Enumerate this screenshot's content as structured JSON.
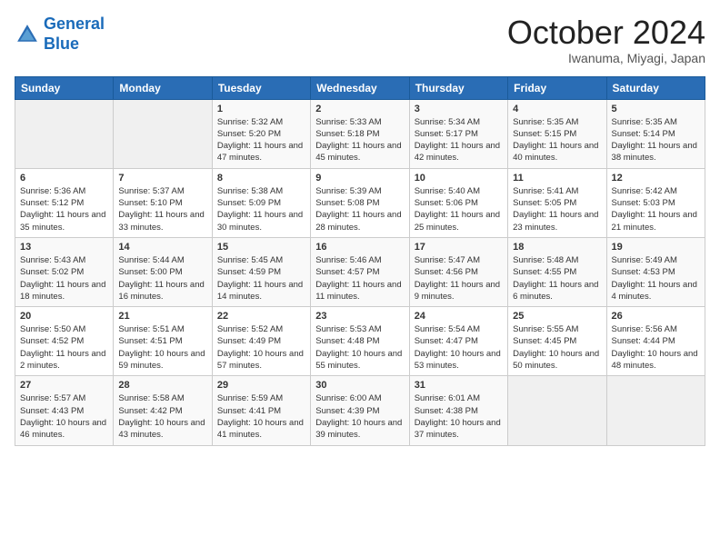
{
  "logo": {
    "line1": "General",
    "line2": "Blue"
  },
  "title": "October 2024",
  "location": "Iwanuma, Miyagi, Japan",
  "weekdays": [
    "Sunday",
    "Monday",
    "Tuesday",
    "Wednesday",
    "Thursday",
    "Friday",
    "Saturday"
  ],
  "weeks": [
    [
      {
        "day": "",
        "info": ""
      },
      {
        "day": "",
        "info": ""
      },
      {
        "day": "1",
        "info": "Sunrise: 5:32 AM\nSunset: 5:20 PM\nDaylight: 11 hours and 47 minutes."
      },
      {
        "day": "2",
        "info": "Sunrise: 5:33 AM\nSunset: 5:18 PM\nDaylight: 11 hours and 45 minutes."
      },
      {
        "day": "3",
        "info": "Sunrise: 5:34 AM\nSunset: 5:17 PM\nDaylight: 11 hours and 42 minutes."
      },
      {
        "day": "4",
        "info": "Sunrise: 5:35 AM\nSunset: 5:15 PM\nDaylight: 11 hours and 40 minutes."
      },
      {
        "day": "5",
        "info": "Sunrise: 5:35 AM\nSunset: 5:14 PM\nDaylight: 11 hours and 38 minutes."
      }
    ],
    [
      {
        "day": "6",
        "info": "Sunrise: 5:36 AM\nSunset: 5:12 PM\nDaylight: 11 hours and 35 minutes."
      },
      {
        "day": "7",
        "info": "Sunrise: 5:37 AM\nSunset: 5:10 PM\nDaylight: 11 hours and 33 minutes."
      },
      {
        "day": "8",
        "info": "Sunrise: 5:38 AM\nSunset: 5:09 PM\nDaylight: 11 hours and 30 minutes."
      },
      {
        "day": "9",
        "info": "Sunrise: 5:39 AM\nSunset: 5:08 PM\nDaylight: 11 hours and 28 minutes."
      },
      {
        "day": "10",
        "info": "Sunrise: 5:40 AM\nSunset: 5:06 PM\nDaylight: 11 hours and 25 minutes."
      },
      {
        "day": "11",
        "info": "Sunrise: 5:41 AM\nSunset: 5:05 PM\nDaylight: 11 hours and 23 minutes."
      },
      {
        "day": "12",
        "info": "Sunrise: 5:42 AM\nSunset: 5:03 PM\nDaylight: 11 hours and 21 minutes."
      }
    ],
    [
      {
        "day": "13",
        "info": "Sunrise: 5:43 AM\nSunset: 5:02 PM\nDaylight: 11 hours and 18 minutes."
      },
      {
        "day": "14",
        "info": "Sunrise: 5:44 AM\nSunset: 5:00 PM\nDaylight: 11 hours and 16 minutes."
      },
      {
        "day": "15",
        "info": "Sunrise: 5:45 AM\nSunset: 4:59 PM\nDaylight: 11 hours and 14 minutes."
      },
      {
        "day": "16",
        "info": "Sunrise: 5:46 AM\nSunset: 4:57 PM\nDaylight: 11 hours and 11 minutes."
      },
      {
        "day": "17",
        "info": "Sunrise: 5:47 AM\nSunset: 4:56 PM\nDaylight: 11 hours and 9 minutes."
      },
      {
        "day": "18",
        "info": "Sunrise: 5:48 AM\nSunset: 4:55 PM\nDaylight: 11 hours and 6 minutes."
      },
      {
        "day": "19",
        "info": "Sunrise: 5:49 AM\nSunset: 4:53 PM\nDaylight: 11 hours and 4 minutes."
      }
    ],
    [
      {
        "day": "20",
        "info": "Sunrise: 5:50 AM\nSunset: 4:52 PM\nDaylight: 11 hours and 2 minutes."
      },
      {
        "day": "21",
        "info": "Sunrise: 5:51 AM\nSunset: 4:51 PM\nDaylight: 10 hours and 59 minutes."
      },
      {
        "day": "22",
        "info": "Sunrise: 5:52 AM\nSunset: 4:49 PM\nDaylight: 10 hours and 57 minutes."
      },
      {
        "day": "23",
        "info": "Sunrise: 5:53 AM\nSunset: 4:48 PM\nDaylight: 10 hours and 55 minutes."
      },
      {
        "day": "24",
        "info": "Sunrise: 5:54 AM\nSunset: 4:47 PM\nDaylight: 10 hours and 53 minutes."
      },
      {
        "day": "25",
        "info": "Sunrise: 5:55 AM\nSunset: 4:45 PM\nDaylight: 10 hours and 50 minutes."
      },
      {
        "day": "26",
        "info": "Sunrise: 5:56 AM\nSunset: 4:44 PM\nDaylight: 10 hours and 48 minutes."
      }
    ],
    [
      {
        "day": "27",
        "info": "Sunrise: 5:57 AM\nSunset: 4:43 PM\nDaylight: 10 hours and 46 minutes."
      },
      {
        "day": "28",
        "info": "Sunrise: 5:58 AM\nSunset: 4:42 PM\nDaylight: 10 hours and 43 minutes."
      },
      {
        "day": "29",
        "info": "Sunrise: 5:59 AM\nSunset: 4:41 PM\nDaylight: 10 hours and 41 minutes."
      },
      {
        "day": "30",
        "info": "Sunrise: 6:00 AM\nSunset: 4:39 PM\nDaylight: 10 hours and 39 minutes."
      },
      {
        "day": "31",
        "info": "Sunrise: 6:01 AM\nSunset: 4:38 PM\nDaylight: 10 hours and 37 minutes."
      },
      {
        "day": "",
        "info": ""
      },
      {
        "day": "",
        "info": ""
      }
    ]
  ]
}
